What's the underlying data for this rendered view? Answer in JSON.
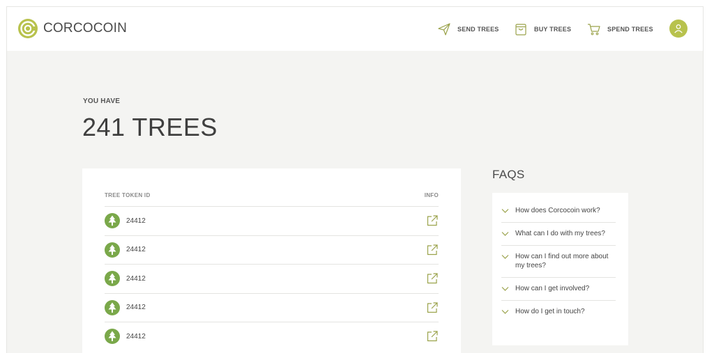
{
  "header": {
    "brand": "CORCOCOIN",
    "nav": [
      {
        "label": "SEND TREES",
        "icon": "send-icon"
      },
      {
        "label": "BUY TREES",
        "icon": "shopping-bag-icon"
      },
      {
        "label": "SPEND TREES",
        "icon": "cart-icon"
      }
    ],
    "avatar_icon": "user-icon"
  },
  "balance": {
    "label": "YOU HAVE",
    "value": "241 TREES"
  },
  "tokens": {
    "columns": {
      "id": "TREE TOKEN ID",
      "info": "INFO"
    },
    "rows": [
      {
        "id": "24412",
        "icon": "tree-icon",
        "action_icon": "external-link-icon"
      },
      {
        "id": "24412",
        "icon": "tree-icon",
        "action_icon": "external-link-icon"
      },
      {
        "id": "24412",
        "icon": "tree-icon",
        "action_icon": "external-link-icon"
      },
      {
        "id": "24412",
        "icon": "tree-icon",
        "action_icon": "external-link-icon"
      },
      {
        "id": "24412",
        "icon": "tree-icon",
        "action_icon": "external-link-icon"
      }
    ]
  },
  "faqs": {
    "title": "FAQS",
    "items": [
      "How does Corcocoin work?",
      "What can I do with my trees?",
      "How can I find out more about my trees?",
      "How can I get involved?",
      "How do I get in touch?"
    ]
  },
  "colors": {
    "accent": "#b8c24d",
    "tree_green": "#7aa84a",
    "background": "#f4f4f2"
  }
}
